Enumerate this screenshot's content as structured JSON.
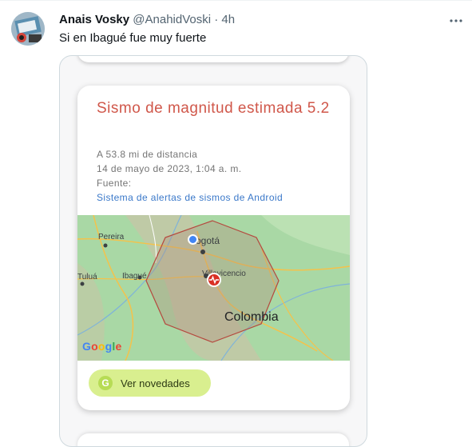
{
  "tweet": {
    "author_name": "Anais Vosky",
    "handle": "@AnahidVoski",
    "separator": "·",
    "time": "4h",
    "text": "Si en Ibagué fue muy fuerte",
    "more_icon": "more-dots-icon"
  },
  "alert_card": {
    "title": "Sismo de magnitud estimada 5.2",
    "distance": "A 53.8 mi de distancia",
    "datetime": "14 de mayo de 2023, 1:04 a. m.",
    "source_label": "Fuente:",
    "source_link": "Sistema de alertas de sismos de Android",
    "map": {
      "labels": {
        "pereira": "Pereira",
        "bogota": "Bogotá",
        "tulua": "Tuluá",
        "ibague": "Ibagué",
        "villavicencio": "Villavicencio",
        "colombia": "Colombia"
      },
      "google_logo": "Google"
    },
    "button_label": "Ver novedades",
    "colors": {
      "title": "#d0574a",
      "link": "#3a78c9",
      "button_bg": "#d9ef8f",
      "map_green": "#a8d8a6",
      "polygon": "#b5483e"
    }
  }
}
